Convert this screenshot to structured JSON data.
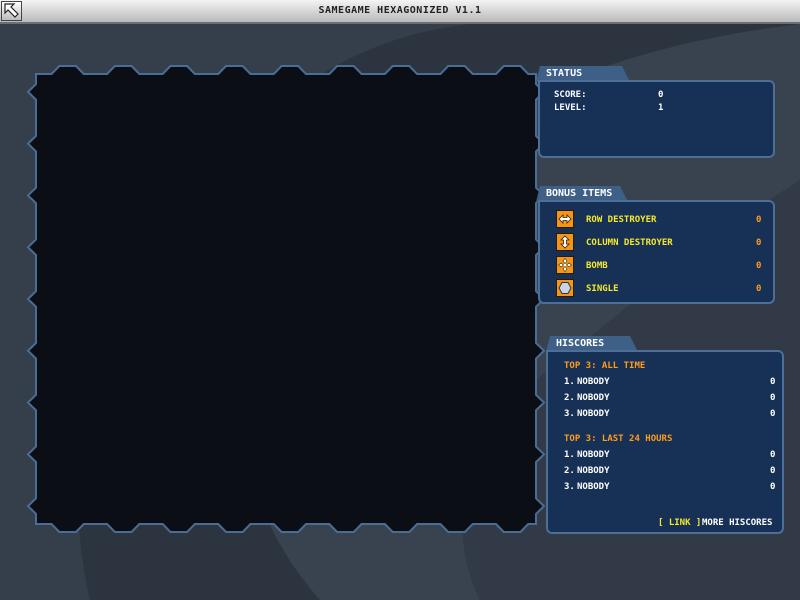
{
  "window": {
    "title": "SAMEGAME HEXAGONIZED V1.1",
    "back_icon": "arrow-up-left-icon"
  },
  "colors": {
    "background": "#2c3440",
    "board": "#0b0f15",
    "panel": "#163056",
    "panel_border": "#4d6f97",
    "label_yellow": "#f5e92a",
    "value_orange": "#ff9c1a",
    "icon_orange": "#f39618"
  },
  "status": {
    "heading": "STATUS",
    "score_label": "SCORE:",
    "score_value": "0",
    "level_label": "LEVEL:",
    "level_value": "1"
  },
  "bonus": {
    "heading": "BONUS ITEMS",
    "items": [
      {
        "label": "ROW DESTROYER",
        "count": "0",
        "icon": "row-destroyer-icon"
      },
      {
        "label": "COLUMN DESTROYER",
        "count": "0",
        "icon": "column-destroyer-icon"
      },
      {
        "label": "BOMB",
        "count": "0",
        "icon": "bomb-icon"
      },
      {
        "label": "SINGLE",
        "count": "0",
        "icon": "single-icon"
      }
    ]
  },
  "hiscores": {
    "heading": "HISCORES",
    "alltime_title": "TOP 3: ALL TIME",
    "alltime": [
      {
        "rank": "1.",
        "name": "NOBODY",
        "score": "0"
      },
      {
        "rank": "2.",
        "name": "NOBODY",
        "score": "0"
      },
      {
        "rank": "3.",
        "name": "NOBODY",
        "score": "0"
      }
    ],
    "last24_title": "TOP 3: LAST 24 HOURS",
    "last24": [
      {
        "rank": "1.",
        "name": "NOBODY",
        "score": "0"
      },
      {
        "rank": "2.",
        "name": "NOBODY",
        "score": "0"
      },
      {
        "rank": "3.",
        "name": "NOBODY",
        "score": "0"
      }
    ],
    "link_label": "[ LINK ]",
    "more_label": "MORE HISCORES"
  }
}
